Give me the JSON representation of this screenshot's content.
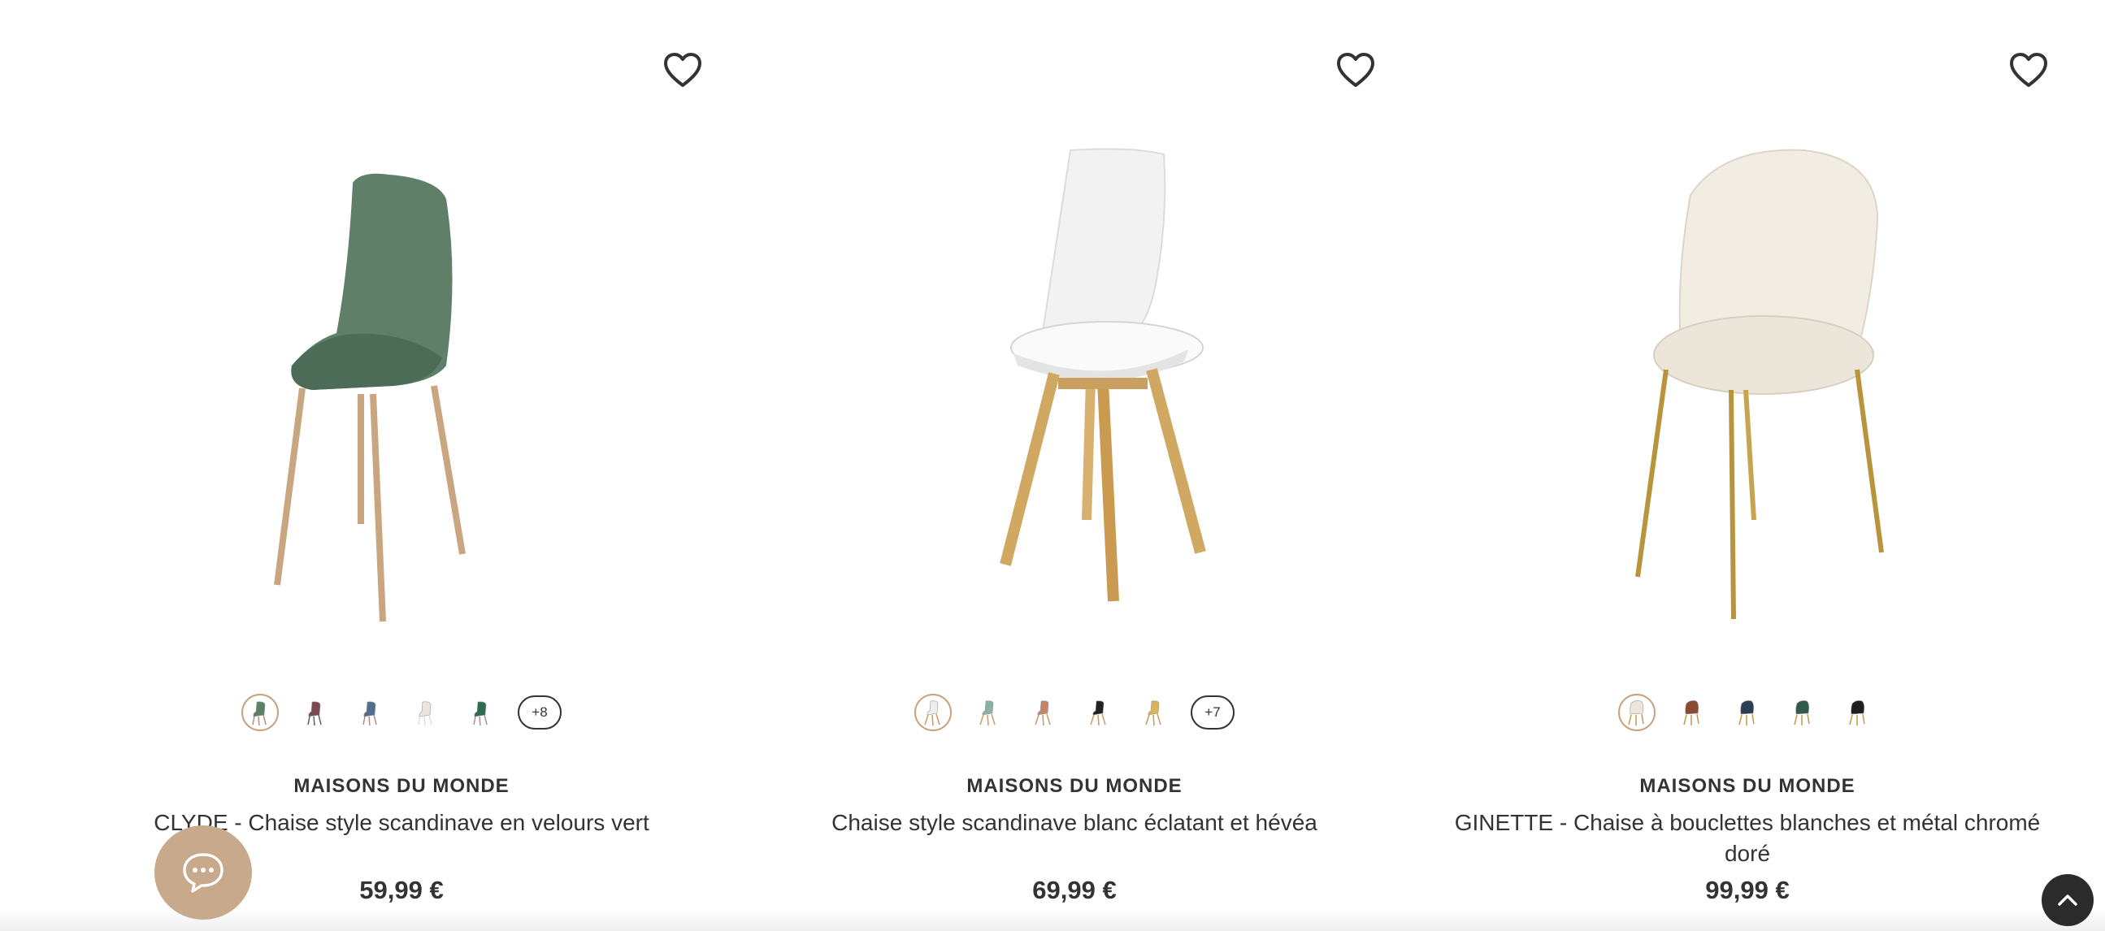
{
  "products": [
    {
      "brand": "MAISONS DU MONDE",
      "title": "CLYDE - Chaise style scandinave en velours vert",
      "price": "59,99 €",
      "image_icon": "green-velvet-chair-photo",
      "swatch_colors": [
        "#5e7f67",
        "#7a4a52",
        "#4f6f8c",
        "#e9e6e0",
        "#2f6b4e"
      ],
      "more_colors": "+8"
    },
    {
      "brand": "MAISONS DU MONDE",
      "title": "Chaise style scandinave blanc éclatant et hévéa",
      "price": "69,99 €",
      "image_icon": "white-scandinavian-chair-photo",
      "swatch_colors": [
        "#eeeeee",
        "#8faea6",
        "#c48567",
        "#222222",
        "#d9b45a"
      ],
      "more_colors": "+7"
    },
    {
      "brand": "MAISONS DU MONDE",
      "title": "GINETTE - Chaise à bouclettes blanches et métal chromé doré",
      "price": "99,99 €",
      "image_icon": "boucle-chair-photo",
      "swatch_colors": [
        "#ece6da",
        "#8a4a32",
        "#2c3e55",
        "#2f5c4a",
        "#1f1f1f"
      ]
    }
  ],
  "accent_color": "#c9a98c"
}
